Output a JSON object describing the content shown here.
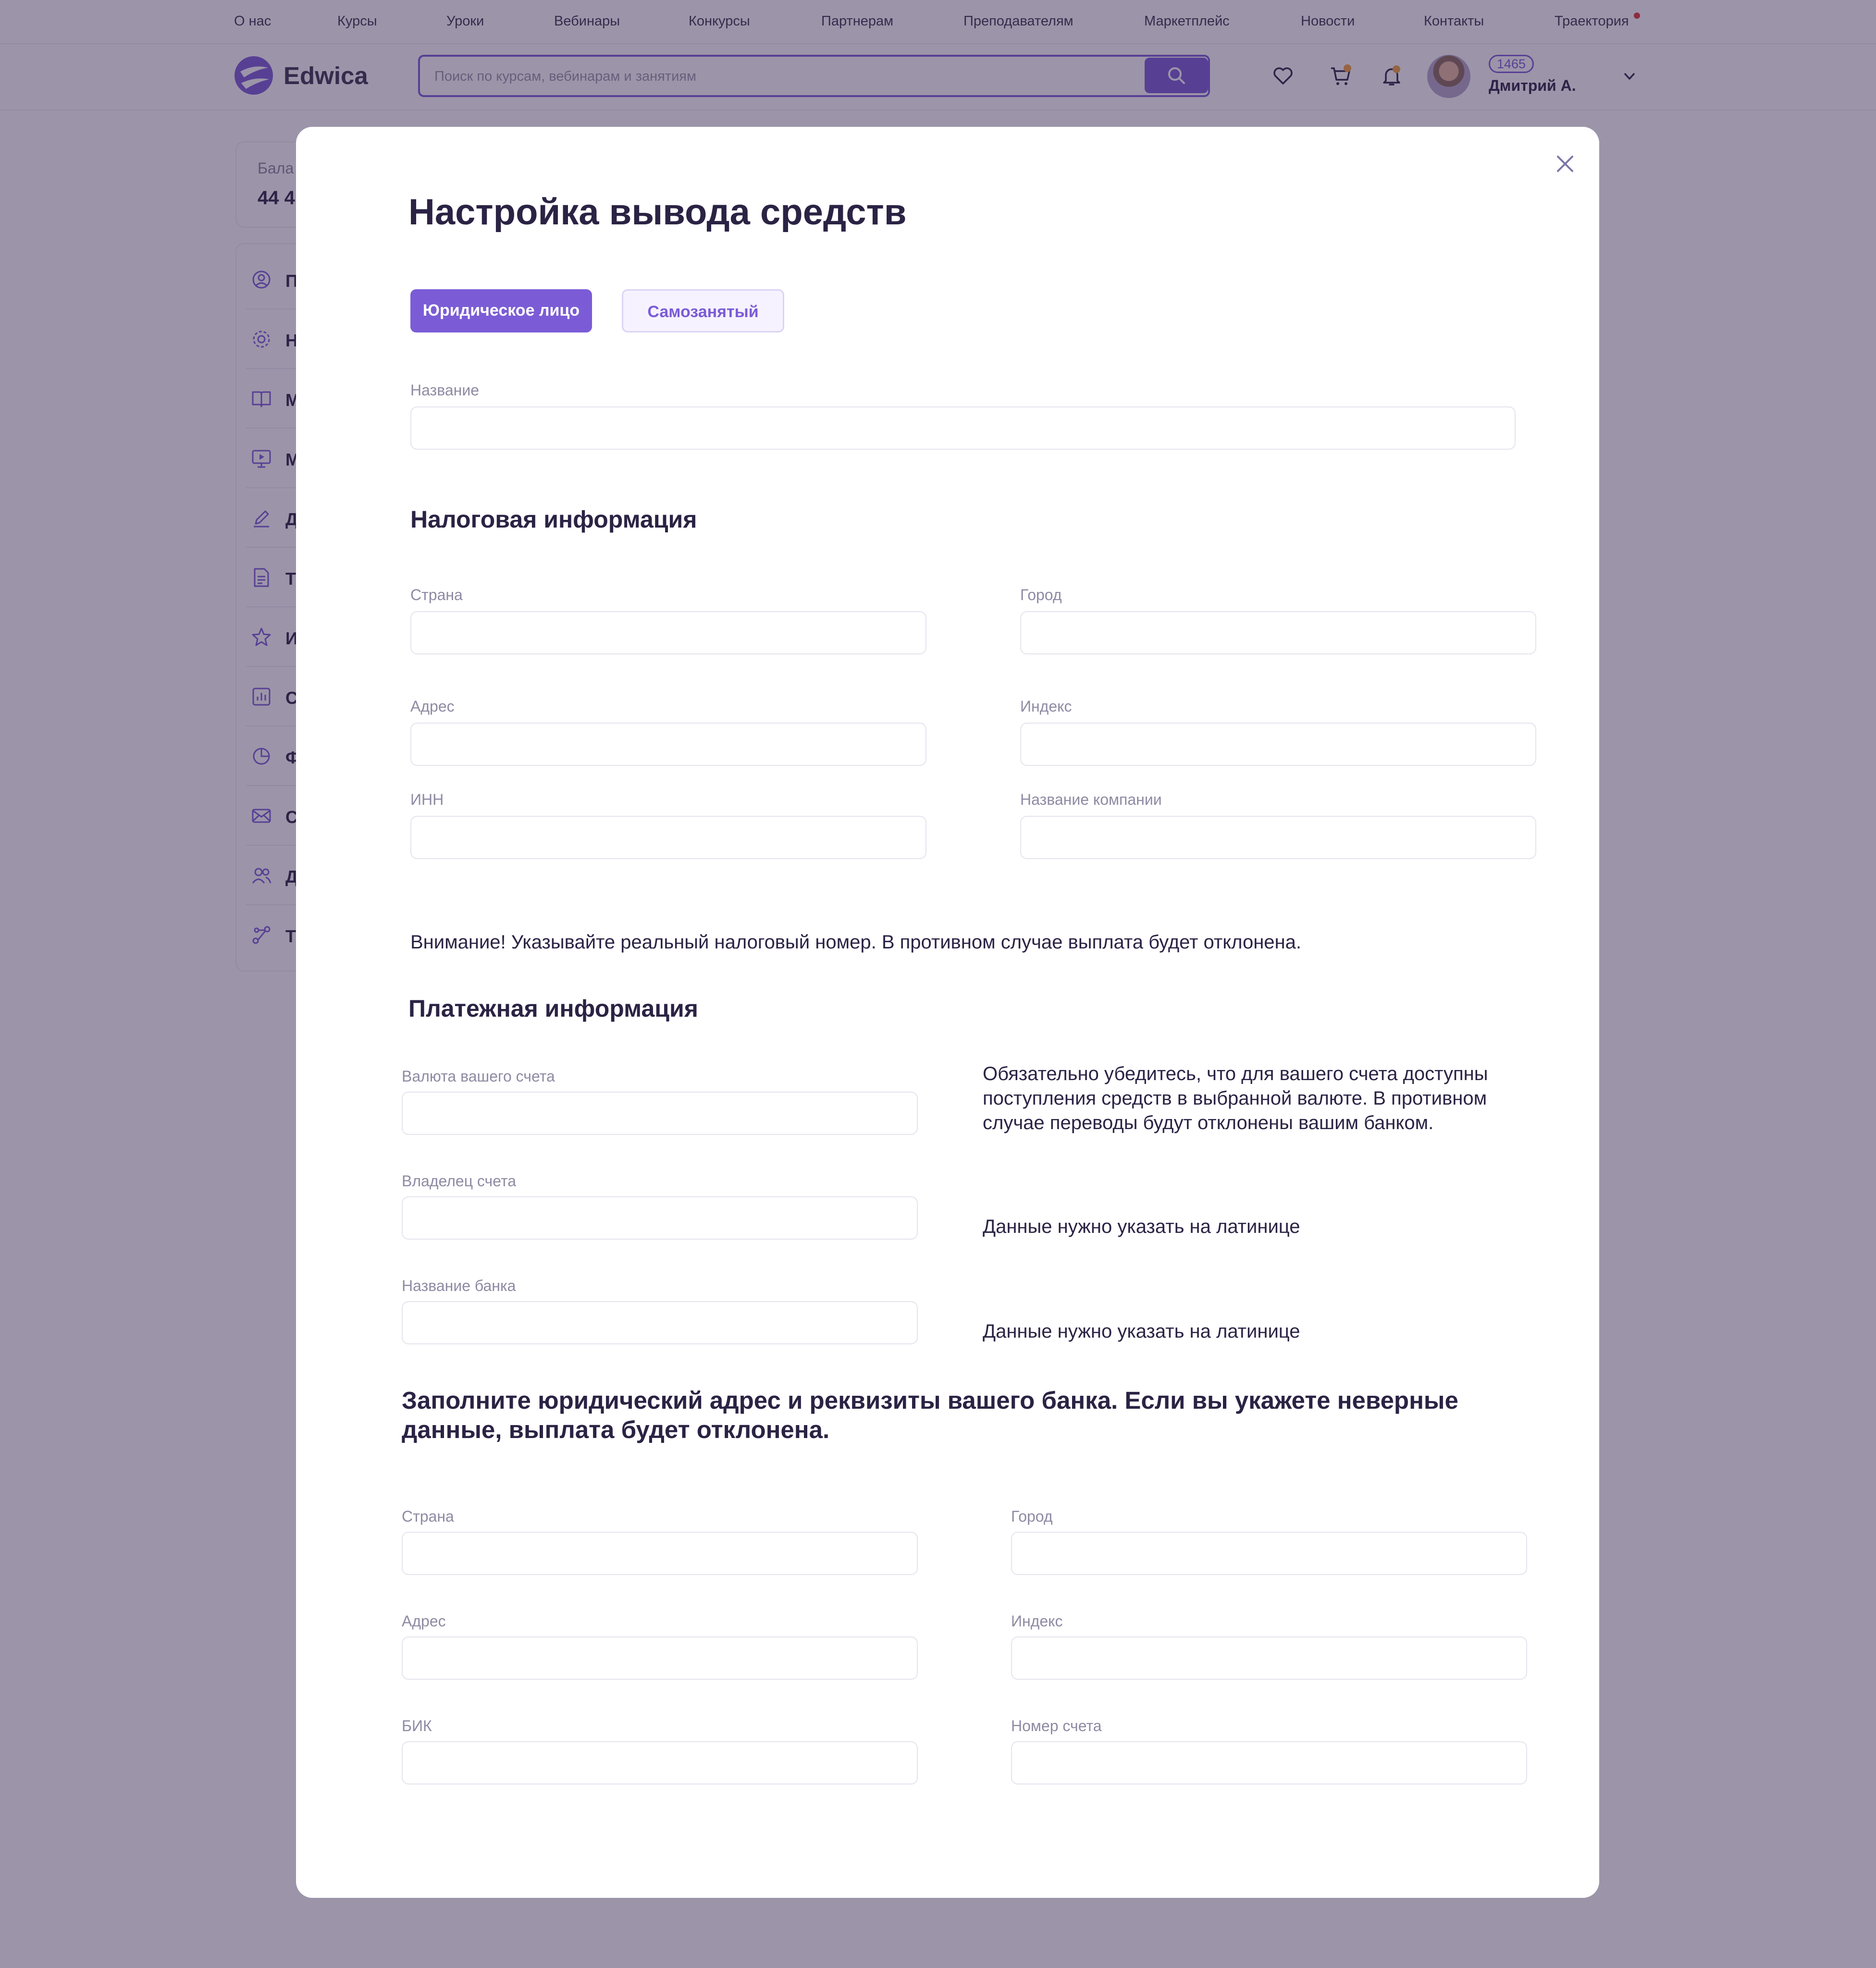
{
  "topnav": {
    "items": [
      "О нас",
      "Курсы",
      "Уроки",
      "Вебинары",
      "Конкурсы",
      "Партнерам",
      "Преподавателям",
      "Маркетплейс",
      "Новости",
      "Контакты",
      "Траектория"
    ]
  },
  "header": {
    "logo_text": "Edwica",
    "search_placeholder": "Поиск по курсам, вебинарам и занятиям",
    "points": "1465",
    "user_name": "Дмитрий А."
  },
  "sidebar": {
    "balance_label": "Бала",
    "balance_value": "44 4",
    "items": [
      {
        "label": "П",
        "icon": "user-circle-icon"
      },
      {
        "label": "Н",
        "icon": "gear-icon"
      },
      {
        "label": "М",
        "icon": "book-icon"
      },
      {
        "label": "М",
        "icon": "video-icon"
      },
      {
        "label": "Д",
        "icon": "pen-icon"
      },
      {
        "label": "Т",
        "icon": "document-icon"
      },
      {
        "label": "И",
        "icon": "star-icon"
      },
      {
        "label": "С",
        "icon": "bar-chart-icon"
      },
      {
        "label": "Ф",
        "icon": "pie-chart-icon"
      },
      {
        "label": "С",
        "icon": "mail-icon"
      },
      {
        "label": "Д",
        "icon": "users-icon"
      },
      {
        "label": "Т",
        "icon": "route-icon"
      }
    ]
  },
  "modal": {
    "title": "Настройка вывода средств",
    "tabs": {
      "active": "Юридическое лицо",
      "inactive": "Самозанятый"
    },
    "name_label": "Название",
    "tax": {
      "title": "Налоговая информация",
      "country": "Страна",
      "city": "Город",
      "address": "Адрес",
      "index": "Индекс",
      "inn": "ИНН",
      "company": "Название компании",
      "warning": "Внимание! Указывайте реальный налоговый номер. В противном случае выплата будет отклонена."
    },
    "payment": {
      "title": "Платежная информация",
      "currency": "Валюта вашего счета",
      "currency_note": "Обязательно убедитесь, что для вашего счета доступны поступления средств в выбранной валюте. В противном случае переводы будут отклонены вашим банком.",
      "owner": "Владелец счета",
      "owner_note": "Данные нужно указать на латинице",
      "bank": "Название банка",
      "bank_note": "Данные нужно указать на латинице"
    },
    "bank_details": {
      "note": "Заполните юридический адрес и реквизиты вашего банка. Если вы укажете неверные данные, выплата будет отклонена.",
      "country": "Страна",
      "city": "Город",
      "address": "Адрес",
      "index": "Индекс",
      "bik": "БИК",
      "account": "Номер счета"
    }
  }
}
